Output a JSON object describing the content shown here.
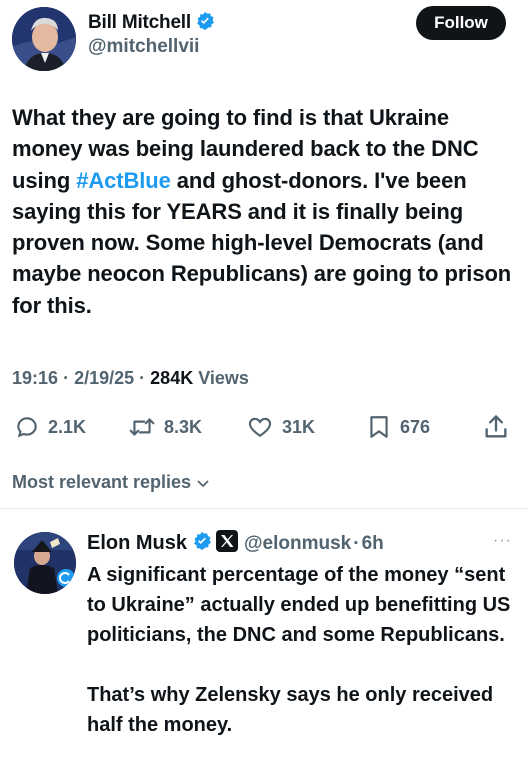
{
  "tweet": {
    "author_name": "Bill Mitchell",
    "author_handle": "@mitchellvii",
    "follow_label": "Follow",
    "text_before_hashtag": "What they are going to find is that Ukraine money was being laundered back to the DNC using ",
    "hashtag": "#ActBlue",
    "text_after_hashtag": " and ghost-donors. I've been saying this for YEARS and it is finally being proven now.  Some high-level Democrats (and maybe neocon Republicans) are going to prison for this.",
    "time": "19:16",
    "date": "2/19/25",
    "views_count": "284K",
    "views_label": "Views",
    "separator": "·"
  },
  "actions": {
    "replies": "2.1K",
    "reposts": "8.3K",
    "likes": "31K",
    "bookmarks": "676"
  },
  "replies_section": {
    "sort_label": "Most relevant replies"
  },
  "reply": {
    "author_name": "Elon Musk",
    "author_handle": "@elonmusk",
    "separator": "·",
    "age": "6h",
    "more": "···",
    "paragraph_1": "A significant percentage of the money “sent to Ukraine” actually ended up benefitting US politicians, the DNC and some Republicans.",
    "paragraph_2": "That’s why Zelensky says he only received half the money."
  },
  "colors": {
    "verified_blue": "#1d9bf0",
    "hashtag_blue": "#1d9bf0",
    "text_primary": "#0f1419",
    "text_secondary": "#536471"
  },
  "icons": [
    "verified-badge-icon",
    "x-logo-icon",
    "reply-icon",
    "repost-icon",
    "like-icon",
    "bookmark-icon",
    "share-icon",
    "chevron-down-icon",
    "more-icon"
  ]
}
